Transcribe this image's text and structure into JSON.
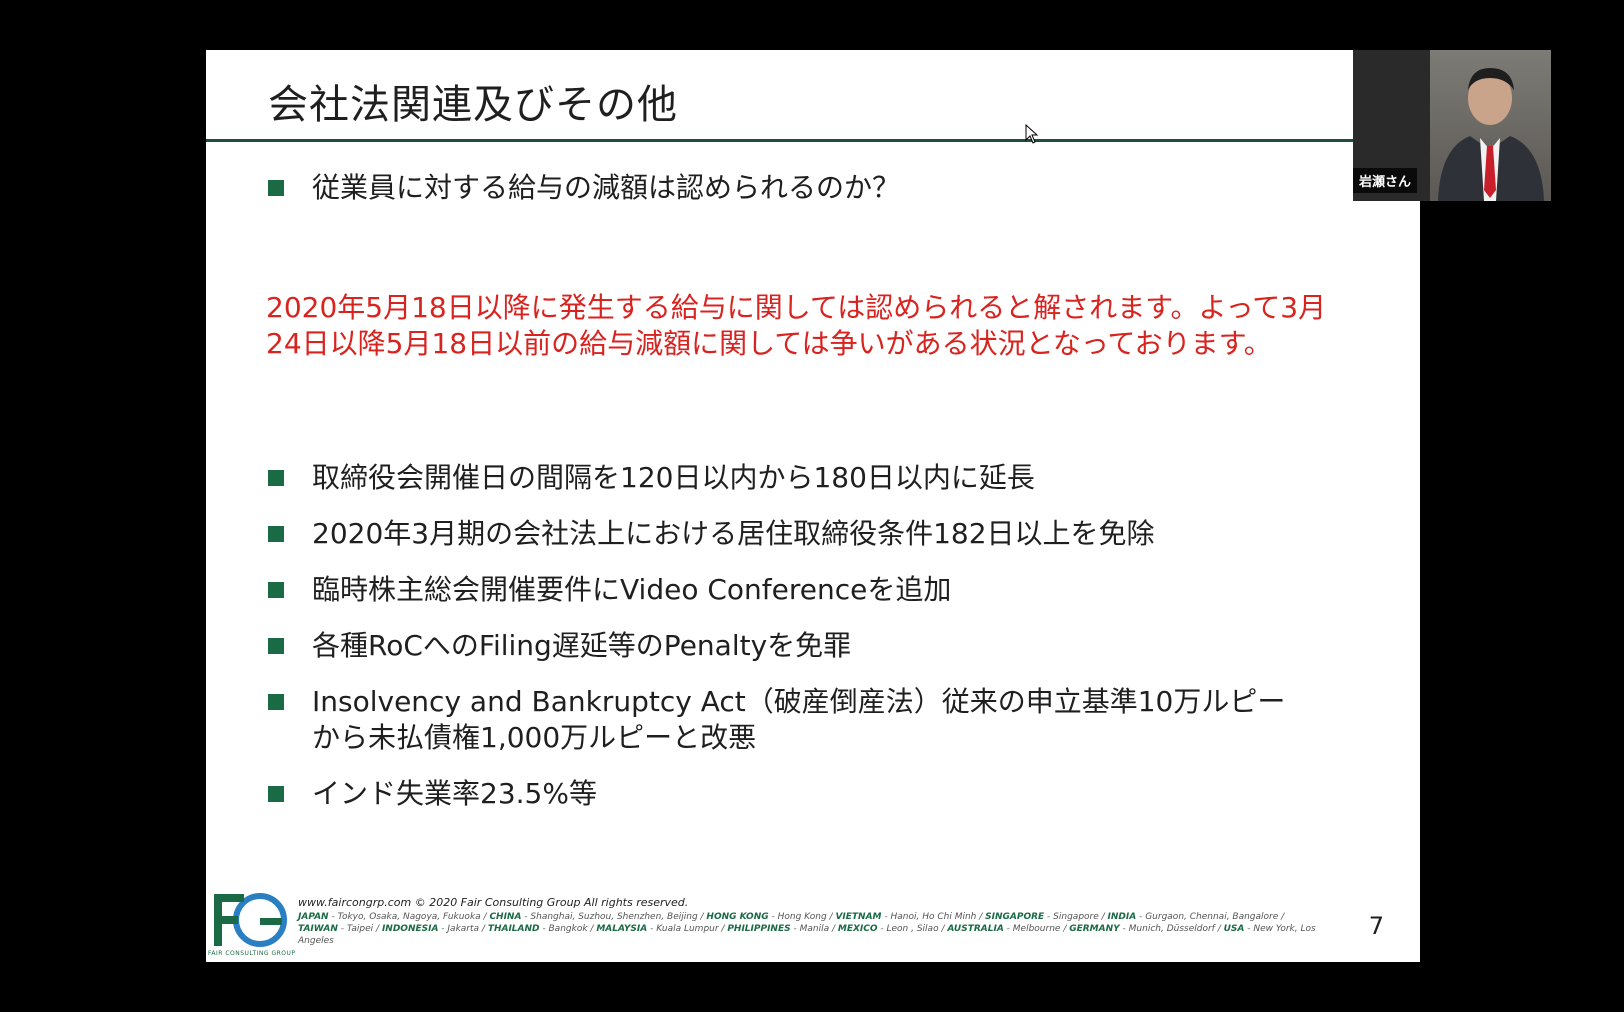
{
  "slide": {
    "title": "会社法関連及びその他",
    "bullet_1": "従業員に対する給与の減額は認められるのか？",
    "red_paragraph": "2020年5月18日以降に発生する給与に関しては認められると解されます。よって3月24日以降5月18日以前の給与減額に関しては争いがある状況となっております。",
    "bullets": [
      "取締役会開催日の間隔を120日以内から180日以内に延長",
      "2020年3月期の会社法上における居住取締役条件182日以上を免除",
      "臨時株主総会開催要件にVideo Conferenceを追加",
      "各種RoCへのFiling遅延等のPenaltyを免罪",
      "Insolvency and Bankruptcy Act（破産倒産法）従来の申立基準10万ルピーから未払債権1,000万ルピーと改悪",
      "インド失業率23.5%等"
    ],
    "page_number": "7"
  },
  "footer": {
    "logo_caption": "FAIR CONSULTING GROUP",
    "copyright": "www.faircongrp.com © 2020 Fair Consulting Group All rights reserved.",
    "locations": [
      {
        "country": "JAPAN",
        "cities": "Tokyo, Osaka, Nagoya, Fukuoka"
      },
      {
        "country": "CHINA",
        "cities": "Shanghai, Suzhou, Shenzhen, Beijing"
      },
      {
        "country": "HONG KONG",
        "cities": "Hong Kong"
      },
      {
        "country": "VIETNAM",
        "cities": "Hanoi, Ho Chi Minh"
      },
      {
        "country": "SINGAPORE",
        "cities": "Singapore"
      },
      {
        "country": "INDIA",
        "cities": "Gurgaon, Chennai, Bangalore"
      },
      {
        "country": "TAIWAN",
        "cities": "Taipei"
      },
      {
        "country": "INDONESIA",
        "cities": "Jakarta"
      },
      {
        "country": "THAILAND",
        "cities": "Bangkok"
      },
      {
        "country": "MALAYSIA",
        "cities": "Kuala Lumpur"
      },
      {
        "country": "PHILIPPINES",
        "cities": "Manila"
      },
      {
        "country": "MEXICO",
        "cities": "Leon , Silao"
      },
      {
        "country": "AUSTRALIA",
        "cities": "Melbourne"
      },
      {
        "country": "GERMANY",
        "cities": "Munich, Düsseldorf"
      },
      {
        "country": "USA",
        "cities": "New York, Los Angeles"
      }
    ]
  },
  "video": {
    "participant_name": "岩瀬さん"
  },
  "colors": {
    "accent_green": "#1a6a45",
    "rule_green": "#1f4f3c",
    "highlight_red": "#d8231f",
    "logo_blue": "#2a7fc2"
  }
}
